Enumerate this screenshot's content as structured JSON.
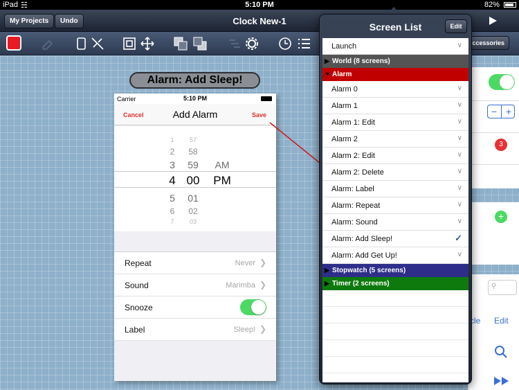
{
  "status": {
    "device": "iPad",
    "time": "5:10 PM",
    "battery": "82%"
  },
  "topbar": {
    "my_projects": "My Projects",
    "undo": "Undo",
    "title": "Clock New-1"
  },
  "screen_label": "Alarm: Add Sleep!",
  "phone": {
    "carrier": "Carrier",
    "time": "5:10 PM",
    "nav": {
      "cancel": "Cancel",
      "title": "Add Alarm",
      "save": "Save"
    },
    "picker": {
      "hours": [
        "1",
        "2",
        "3",
        "4",
        "5",
        "6",
        "7"
      ],
      "minutes": [
        "57",
        "58",
        "59",
        "00",
        "01",
        "02",
        "03"
      ],
      "ampm": [
        "AM",
        "PM"
      ]
    },
    "settings": [
      {
        "label": "Repeat",
        "value": "Never"
      },
      {
        "label": "Sound",
        "value": "Marimba"
      },
      {
        "label": "Snooze",
        "value": ""
      },
      {
        "label": "Label",
        "value": "Sleep!"
      }
    ],
    "snooze_on": true
  },
  "popover": {
    "title": "Screen List",
    "edit": "Edit",
    "launch": "Launch",
    "groups": {
      "world": "World (8 screens)",
      "alarm": "Alarm",
      "stopwatch": "Stopwatch (5 screens)",
      "timer": "Timer (2 screens)"
    },
    "alarm_items": [
      "Alarm 0",
      "Alarm 1",
      "Alarm 1: Edit",
      "Alarm 2",
      "Alarm 2: Edit",
      "Alarm 2: Delete",
      "Alarm: Label",
      "Alarm: Repeat",
      "Alarm: Sound",
      "Alarm: Add Sleep!",
      "Alarm: Add Get Up!"
    ],
    "selected": "Alarm: Add Sleep!"
  },
  "background": {
    "accessories": "ccessories",
    "cle": "cle",
    "edit": "Edit",
    "badge": "3"
  },
  "colors": {
    "alarm_group": "#c00000",
    "world_group": "#545454",
    "stopwatch_group": "#2e2e8a",
    "timer_group": "#0e7a0e",
    "accent_red": "#e0302f",
    "toggle_on": "#4cd964"
  }
}
